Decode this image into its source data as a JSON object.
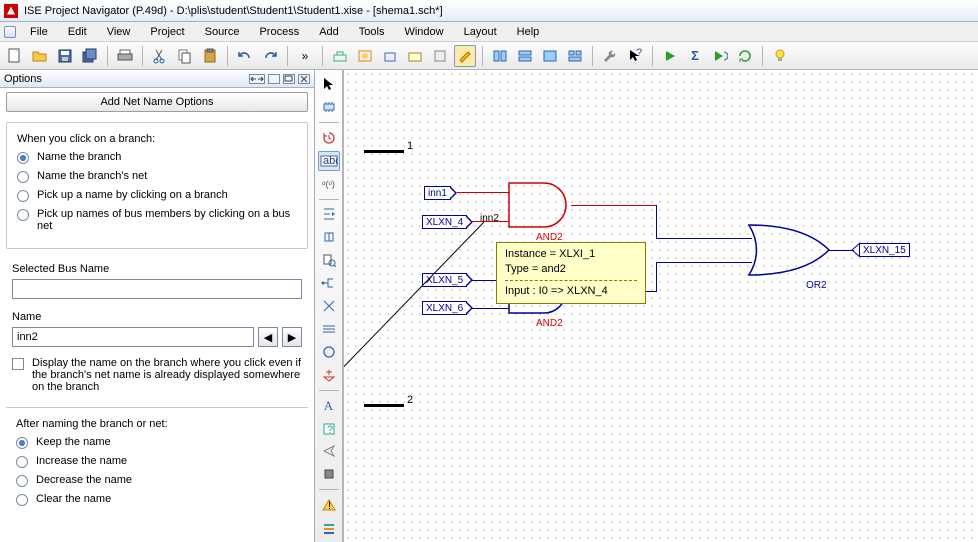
{
  "window": {
    "title": "ISE Project Navigator (P.49d) - D:\\plis\\student\\Student1\\Student1.xise - [shema1.sch*]"
  },
  "menu": {
    "items": [
      "File",
      "Edit",
      "View",
      "Project",
      "Source",
      "Process",
      "Add",
      "Tools",
      "Window",
      "Layout",
      "Help"
    ]
  },
  "options": {
    "panel_title": "Options",
    "big_button": "Add Net Name Options",
    "branch_heading": "When you click on a branch:",
    "radios1": [
      "Name the branch",
      "Name the branch's net",
      "Pick up a name by clicking on a branch",
      "Pick up names of bus members by clicking on a bus net"
    ],
    "selected_bus_label": "Selected Bus Name",
    "selected_bus_value": "",
    "name_label": "Name",
    "name_value": "inn2",
    "display_check": "Display the name on the branch where you click even if the branch's net name is already displayed somewhere on the branch",
    "after_heading": "After naming the branch or net:",
    "radios2": [
      "Keep the name",
      "Increase the name",
      "Decrease the name",
      "Clear the name"
    ]
  },
  "canvas": {
    "markers": {
      "top": "1",
      "bottom": "2"
    },
    "nets": {
      "inn1": "inn1",
      "inn2": "inn2",
      "xlxn4": "XLXN_4",
      "xlxn5": "XLXN_5",
      "xlxn6": "XLXN_6",
      "xlxn15": "XLXN_15"
    },
    "gates": {
      "and_top": "AND2",
      "and_bot": "AND2",
      "or": "OR2"
    },
    "tooltip": {
      "instance": "Instance = XLXI_1",
      "type": "Type = and2",
      "input": "Input : I0 => XLXN_4"
    }
  },
  "icons": {
    "new": "new-file",
    "open": "open",
    "save": "save",
    "saveall": "save-all",
    "print": "print",
    "cut": "cut",
    "copy": "copy",
    "paste": "paste",
    "undo": "undo",
    "redo": "redo",
    "more": "more",
    "run": "play",
    "sigma": "sigma",
    "runb": "play-loop",
    "refresh": "refresh",
    "find": "find",
    "help": "help",
    "bulb": "bulb",
    "cursor": "cursor",
    "select": "select-chip",
    "history": "history",
    "abc": "abc-label",
    "zoom-flag": "zoom",
    "hier-down": "hier-down",
    "flip": "flip",
    "lookup": "lookup",
    "net": "net",
    "branch": "branch",
    "bus": "bus",
    "circle": "circle",
    "power": "power",
    "text-a": "text-a",
    "qmark": "check",
    "send": "send",
    "hw": "hardware",
    "warn": "warning",
    "stack": "stack"
  }
}
